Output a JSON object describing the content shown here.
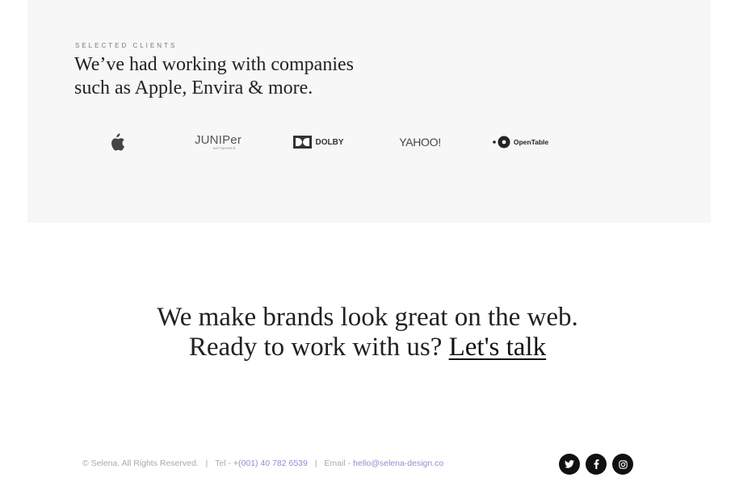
{
  "clients": {
    "eyebrow": "SELECTED CLIENTS",
    "heading_line1": "We’ve had working with companies",
    "heading_line2": "such as Apple, Envira & more.",
    "logos": [
      {
        "name": "apple-logo-icon"
      },
      {
        "name": "juniper-logo",
        "text": "JUNIPer",
        "subtext": "NETWORKS"
      },
      {
        "name": "dolby-logo",
        "text": "DOLBY"
      },
      {
        "name": "yahoo-logo",
        "text": "YAHOO!"
      },
      {
        "name": "opentable-logo",
        "text": "OpenTable"
      }
    ]
  },
  "cta": {
    "line1": "We make brands look great on the web.",
    "line2_prefix": "Ready to work with us?",
    "link_text": "Let's talk"
  },
  "footer": {
    "copyright": "© Selena. All Rights Reserved.",
    "divider": "|",
    "tel_label": "Tel -",
    "tel_value": "+(001) 40 782 6539",
    "email_label": "Email -",
    "email_value": "hello@selena-design.co",
    "social": [
      {
        "name": "twitter-icon"
      },
      {
        "name": "facebook-icon"
      },
      {
        "name": "instagram-icon"
      }
    ]
  },
  "colors": {
    "band_bg": "#f7f7f7",
    "text": "#222222",
    "footer_text": "#a8a8a8",
    "footer_link": "#8f8fcf",
    "social_bg": "#111111"
  }
}
